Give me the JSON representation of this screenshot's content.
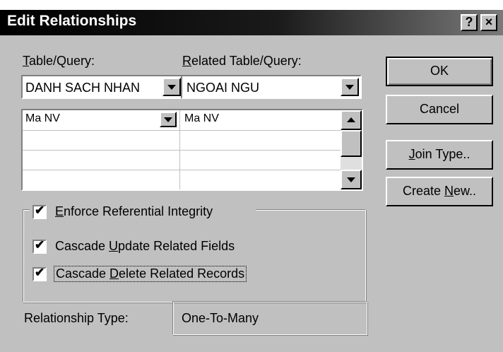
{
  "window": {
    "title": "Edit Relationships",
    "help_label": "?",
    "close_label": "×"
  },
  "labels": {
    "table_query": "Table/Query:",
    "related_table_query": "Related Table/Query:",
    "relationship_type": "Relationship Type:"
  },
  "combos": {
    "table": "DANH SACH NHAN",
    "related_table": "NGOAI NGU"
  },
  "fields_grid": {
    "rows": [
      {
        "left": "Ma NV",
        "right": "Ma NV"
      },
      {
        "left": "",
        "right": ""
      },
      {
        "left": "",
        "right": ""
      },
      {
        "left": "",
        "right": ""
      }
    ]
  },
  "checkboxes": {
    "enforce": {
      "label": "Enforce Referential Integrity",
      "checked": true
    },
    "cascade_update": {
      "label": "Cascade Update Related Fields",
      "checked": true
    },
    "cascade_delete": {
      "label": "Cascade Delete Related Records",
      "checked": true
    }
  },
  "relationship_type_value": "One-To-Many",
  "buttons": {
    "ok": "OK",
    "cancel": "Cancel",
    "join_type": "Join Type..",
    "create_new": "Create New.."
  }
}
